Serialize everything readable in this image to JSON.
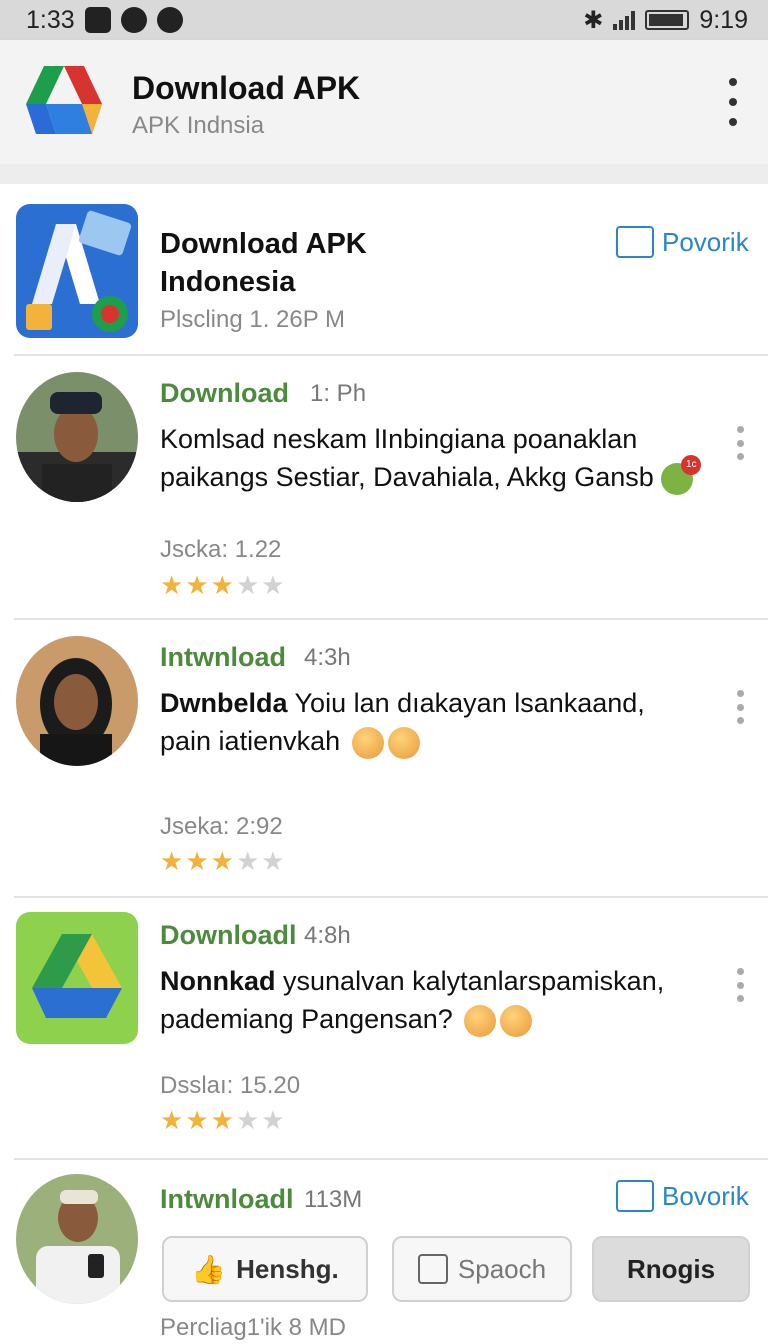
{
  "status_bar": {
    "time": "1:33",
    "clock_right": "9:19",
    "icons_left": [
      "u-icon",
      "settings-circle-icon",
      "shield-icon"
    ],
    "icons_right": [
      "bluetooth-icon",
      "signal-icon",
      "battery-icon"
    ]
  },
  "app_bar": {
    "title": "Download APK",
    "subtitle": "APK Indnsia"
  },
  "feed": {
    "header_item": {
      "title_line1": "Download APK",
      "title_line2": "Indonesia",
      "meta": "Plscling 1. 26P M",
      "link_label": "Povorik"
    },
    "posts": [
      {
        "name": "Download",
        "time": "1: Ph",
        "text_line1": "Komlsad neskam lInbingiana poanaklan",
        "text_line2": "paikangs Sestiar, Davahiala, Akkg Gansb",
        "meta": "Jscka: 1.22",
        "rating": 3,
        "badge": "1c"
      },
      {
        "name": "Intwnload",
        "time": "4:3h",
        "text_bold": "Dwnbelda",
        "text_line1": " Yoiu lan dıakayan lsankaand,",
        "text_line2": "pain iatienvkah",
        "meta": "Jseka: 2:92",
        "rating": 3
      },
      {
        "name": "Downloadl",
        "time": "4:8h",
        "text_bold": "Nonnkad",
        "text_line1": " ysunalvan kalytanlarspamiskan,",
        "text_line2": "pademiang Pangensan?",
        "meta": "Dsslaı: 15.20",
        "rating": 3
      },
      {
        "name": "Intwnloadl",
        "time": "113M",
        "link_label": "Bovorik",
        "buttons": {
          "like": "Henshg.",
          "check": "Spaoch",
          "grey": "Rnogis"
        },
        "meta": "Percliag1'ik  8  MD"
      }
    ]
  }
}
